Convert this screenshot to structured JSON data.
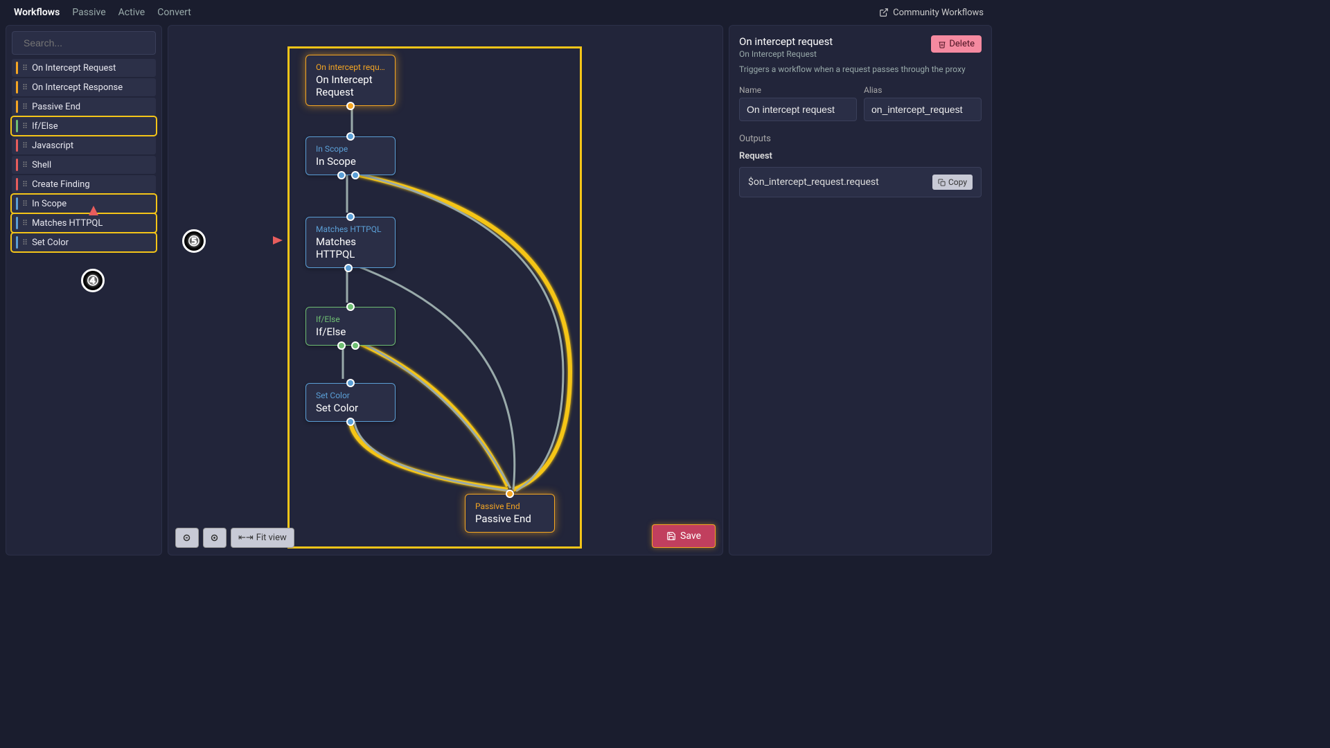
{
  "topbar": {
    "tabs": [
      "Workflows",
      "Passive",
      "Active",
      "Convert"
    ],
    "active_tab": "Workflows",
    "community": "Community Workflows"
  },
  "search": {
    "placeholder": "Search..."
  },
  "sidebar_nodes": [
    {
      "label": "On Intercept Request",
      "color": "#f5a623",
      "hl": false
    },
    {
      "label": "On Intercept Response",
      "color": "#f5a623",
      "hl": false
    },
    {
      "label": "Passive End",
      "color": "#f5a623",
      "hl": false
    },
    {
      "label": "If/Else",
      "color": "#6fbf73",
      "hl": true
    },
    {
      "label": "Javascript",
      "color": "#e85d5d",
      "hl": false
    },
    {
      "label": "Shell",
      "color": "#e85d5d",
      "hl": false
    },
    {
      "label": "Create Finding",
      "color": "#e85d5d",
      "hl": false
    },
    {
      "label": "In Scope",
      "color": "#5b9fd6",
      "hl": true
    },
    {
      "label": "Matches HTTPQL",
      "color": "#5b9fd6",
      "hl": true
    },
    {
      "label": "Set Color",
      "color": "#5b9fd6",
      "hl": true
    }
  ],
  "flow_nodes": {
    "n1": {
      "type": "On intercept requ…",
      "title": "On Intercept\nRequest"
    },
    "n2": {
      "type": "In Scope",
      "title": "In Scope"
    },
    "n3": {
      "type": "Matches HTTPQL",
      "title": "Matches\nHTTPQL"
    },
    "n4": {
      "type": "If/Else",
      "title": "If/Else"
    },
    "n5": {
      "type": "Set Color",
      "title": "Set Color"
    },
    "n6": {
      "type": "Passive End",
      "title": "Passive End"
    }
  },
  "canvas_controls": {
    "fit": "Fit view"
  },
  "save": "Save",
  "rightpanel": {
    "title": "On intercept request",
    "subtitle": "On Intercept Request",
    "desc": "Triggers a workflow when a request passes through the proxy",
    "delete": "Delete",
    "name_label": "Name",
    "name_value": "On intercept request",
    "alias_label": "Alias",
    "alias_value": "on_intercept_request",
    "outputs_label": "Outputs",
    "request_label": "Request",
    "request_value": "$on_intercept_request.request",
    "copy": "Copy"
  },
  "annotations": {
    "a4": "④",
    "a5": "⑤"
  }
}
